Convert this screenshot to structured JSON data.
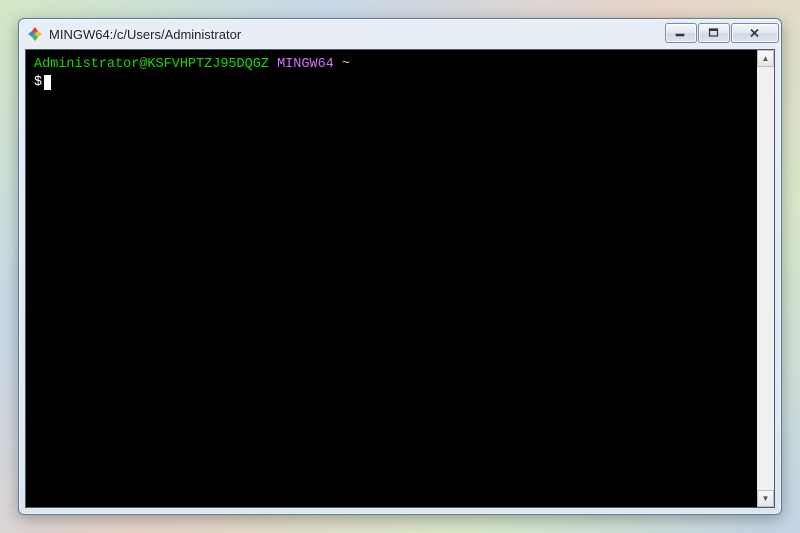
{
  "window": {
    "title": "MINGW64:/c/Users/Administrator"
  },
  "controls": {
    "minimize_label": "Minimize",
    "maximize_label": "Maximize",
    "close_label": "Close"
  },
  "terminal": {
    "user_host": "Administrator@KSFVHPTZJ95DQGZ",
    "env": "MINGW64",
    "cwd": "~",
    "prompt": "$"
  },
  "scrollbar": {
    "up": "▲",
    "down": "▼"
  }
}
